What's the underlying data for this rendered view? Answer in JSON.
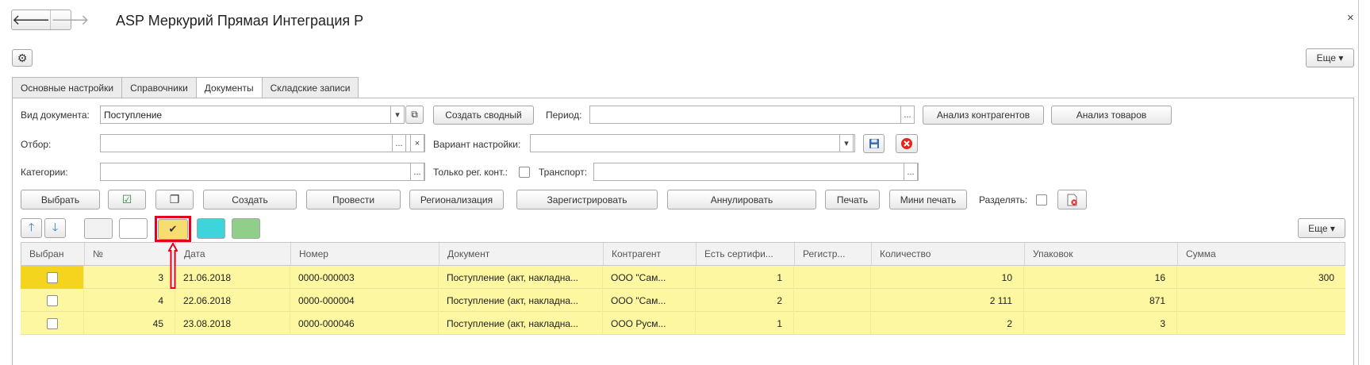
{
  "window": {
    "title": "ASP Меркурий Прямая Интеграция Р",
    "close_glyph": "×",
    "back_glyph": "🡐",
    "forward_glyph": "🡒"
  },
  "toolbar": {
    "settings_glyph": "⚙",
    "more_label": "Еще ▾"
  },
  "tabs": [
    {
      "label": "Основные настройки",
      "active": false
    },
    {
      "label": "Справочники",
      "active": false
    },
    {
      "label": "Документы",
      "active": true
    },
    {
      "label": "Складские записи",
      "active": false
    }
  ],
  "filters": {
    "doc_type_label": "Вид документа:",
    "doc_type_value": "Поступление",
    "create_summary_label": "Создать сводный",
    "period_label": "Период:",
    "period_value": "",
    "counterparty_analysis_label": "Анализ контрагентов",
    "goods_analysis_label": "Анализ товаров",
    "selection_label": "Отбор:",
    "selection_value": "",
    "settings_variant_label": "Вариант настройки:",
    "settings_variant_value": "",
    "categories_label": "Категории:",
    "categories_value": "",
    "reg_only_label": "Только рег. конт.:",
    "transport_label": "Транспорт:",
    "transport_value": "",
    "dots": "...",
    "clear_glyph": "×",
    "dropdown_glyph": "▾",
    "open_glyph": "⧉"
  },
  "actions": {
    "choose": "Выбрать",
    "create": "Создать",
    "post": "Провести",
    "regionalize": "Регионализация",
    "register": "Зарегистрировать",
    "cancel": "Аннулировать",
    "print": "Печать",
    "mini_print": "Мини печать",
    "split_label": "Разделять:",
    "check_icon": "☑",
    "copy_icon": "❐",
    "up_glyph": "🡑",
    "down_glyph": "🡓",
    "yellow_check_glyph": "✔"
  },
  "colors": {
    "row_highlight": "#fcf7a0",
    "selected_cell": "#f4d41c",
    "swatch_yellow": "#f7dc6f",
    "swatch_cyan": "#3ed4dc",
    "swatch_green": "#8fcf8a",
    "annotation": "#e8001c"
  },
  "table": {
    "columns": [
      "Выбран",
      "№",
      "Дата",
      "Номер",
      "Документ",
      "Контрагент",
      "Есть сертифи...",
      "Регистр...",
      "Количество",
      "Упаковок",
      "Сумма"
    ],
    "rows": [
      {
        "num": "3",
        "date": "21.06.2018",
        "number": "0000-000003",
        "document": "Поступление (акт, накладна...",
        "counterparty": "ООО \"Сам...",
        "has_cert": "1",
        "reg": "",
        "qty": "10",
        "packs": "16",
        "sum": "300"
      },
      {
        "num": "4",
        "date": "22.06.2018",
        "number": "0000-000004",
        "document": "Поступление (акт, накладна...",
        "counterparty": "ООО \"Сам...",
        "has_cert": "2",
        "reg": "",
        "qty": "2 111",
        "packs": "871",
        "sum": ""
      },
      {
        "num": "45",
        "date": "23.08.2018",
        "number": "0000-000046",
        "document": "Поступление (акт, накладна...",
        "counterparty": "ООО Русм...",
        "has_cert": "1",
        "reg": "",
        "qty": "2",
        "packs": "3",
        "sum": ""
      }
    ]
  }
}
